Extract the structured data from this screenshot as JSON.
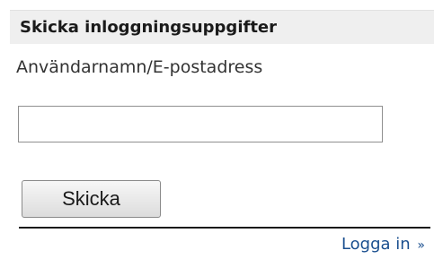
{
  "panel": {
    "title": "Skicka inloggningsuppgifter"
  },
  "form": {
    "field_label": "Användarnamn/E-postadress",
    "input_value": "",
    "submit_label": "Skicka"
  },
  "footer": {
    "login_link_label": "Logga in",
    "login_link_arrow": "»"
  },
  "colors": {
    "header_background": "#efefef",
    "link": "#1a4f8f",
    "divider": "#1a1a1a"
  }
}
